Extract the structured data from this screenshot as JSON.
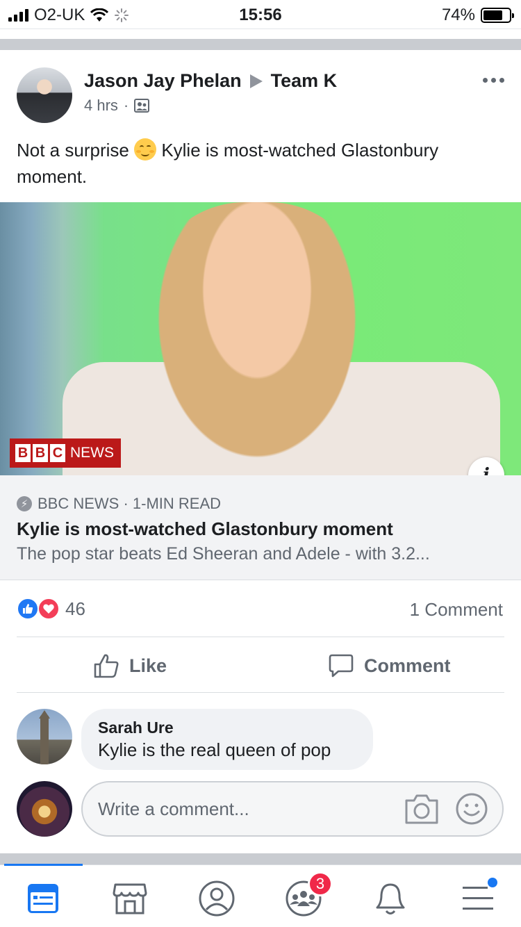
{
  "status_bar": {
    "carrier": "O2-UK",
    "time": "15:56",
    "battery": "74%",
    "battery_level": 0.74
  },
  "post": {
    "author": "Jason Jay Phelan",
    "group": "Team K",
    "time": "4 hrs",
    "separator": "·",
    "privacy_icon": "group-icon",
    "text_before": "Not a surprise",
    "emoji": "smiling-face-icon",
    "text_after": "Kylie is most-watched Glastonbury moment.",
    "image_watermark": {
      "box1": "B",
      "box2": "B",
      "box3": "C",
      "word": "NEWS"
    }
  },
  "link_preview": {
    "source": "BBC NEWS · 1-MIN READ",
    "title": "Kylie is most-watched Glastonbury moment",
    "description": "The pop star beats Ed Sheeran and Adele - with 3.2..."
  },
  "reactions": {
    "count": "46",
    "comments": "1 Comment"
  },
  "actions": {
    "like": "Like",
    "comment": "Comment"
  },
  "comment": {
    "author": "Sarah Ure",
    "text": "Kylie is the real queen of pop"
  },
  "composer": {
    "placeholder": "Write a comment..."
  },
  "tabs": {
    "items": [
      "news-feed-icon",
      "marketplace-icon",
      "profile-icon",
      "groups-icon",
      "notifications-icon",
      "menu-icon"
    ],
    "groups_badge": "3",
    "colors": {
      "active": "#1877f2",
      "inactive": "#606770",
      "badge": "#f02849"
    }
  }
}
